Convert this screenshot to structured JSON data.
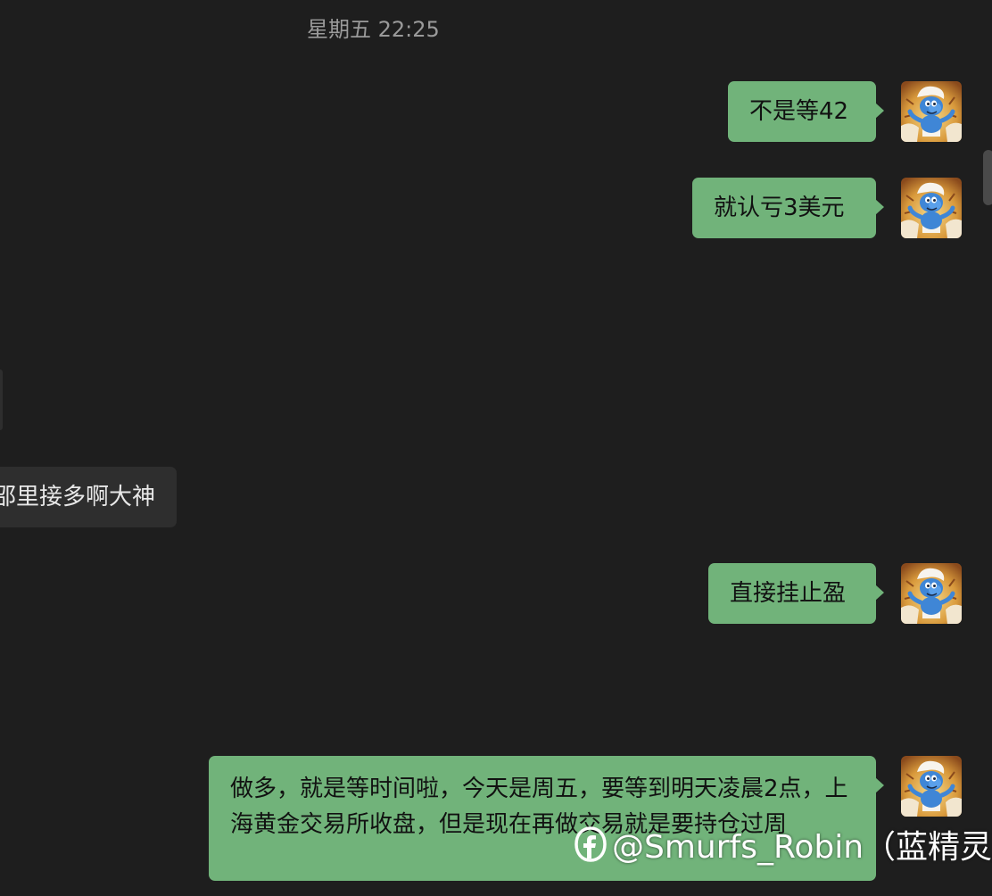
{
  "chat": {
    "timestamp": "星期五 22:25",
    "messages": [
      {
        "direction": "out",
        "text": "不是等42",
        "avatar": "smurf-avatar"
      },
      {
        "direction": "out",
        "text": "就认亏3美元",
        "avatar": "smurf-avatar"
      },
      {
        "direction": "in",
        "text": "",
        "partial": true
      },
      {
        "direction": "in",
        "text": "邵里接多啊大神",
        "partial": true
      },
      {
        "direction": "out",
        "text": "直接挂止盈",
        "avatar": "smurf-avatar"
      },
      {
        "direction": "out",
        "text": "做多，就是等时间啦，今天是周五，要等到明天凌晨2点，上海黄金交易所收盘，但是现在再做交易就是要持仓过周",
        "avatar": "smurf-avatar"
      }
    ]
  },
  "watermark": {
    "logo_icon": "watermark-logo-icon",
    "text": "@Smurfs_Robin（蓝精灵）"
  },
  "colors": {
    "background": "#1e1e1e",
    "outgoing_bubble": "#71b37a",
    "incoming_bubble": "#2e2e2e",
    "timestamp": "#9a9a9a"
  }
}
